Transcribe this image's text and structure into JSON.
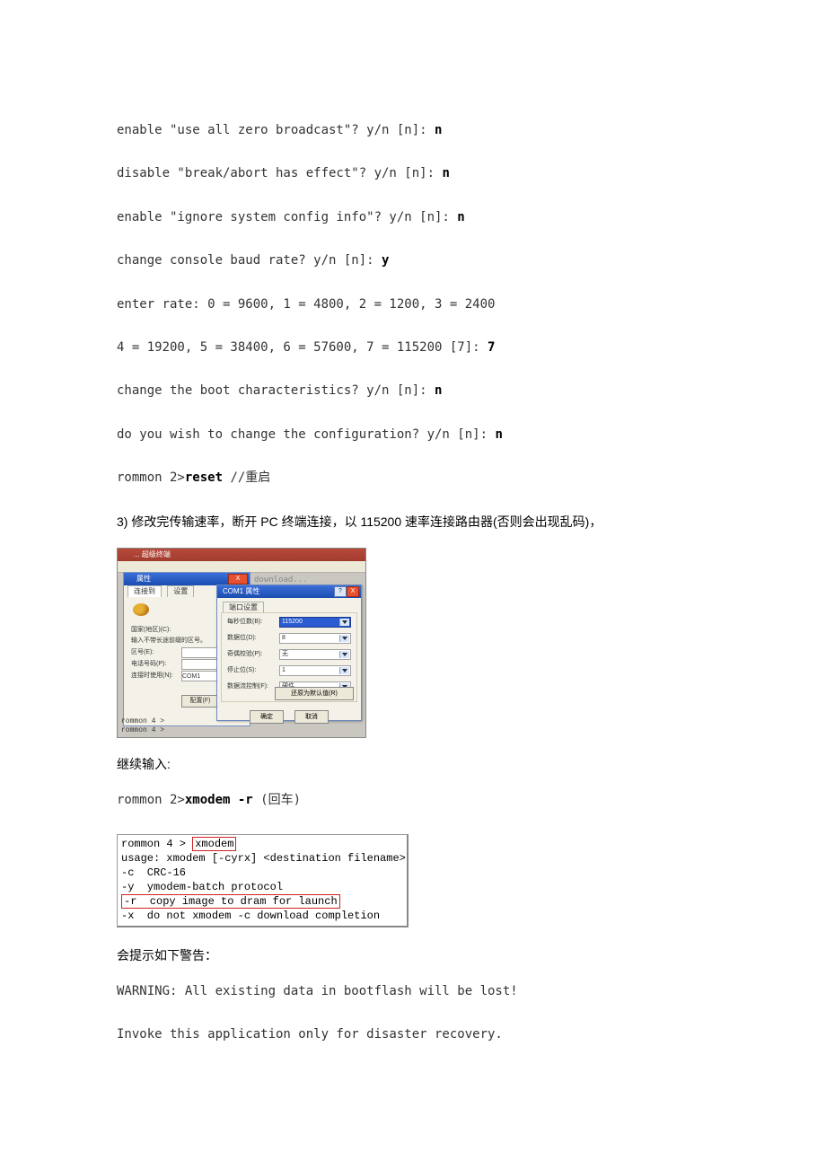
{
  "lines": {
    "l1a": "enable \"use all zero broadcast\"? y/n [n]: ",
    "l1b": "n",
    "l2a": "disable \"break/abort has effect\"? y/n [n]: ",
    "l2b": "n",
    "l3a": "enable \"ignore system config info\"? y/n [n]: ",
    "l3b": "n",
    "l4a": "change console baud rate? y/n [n]: ",
    "l4b": "y",
    "l5": "enter rate: 0 = 9600, 1 = 4800, 2 = 1200, 3 = 2400",
    "l6a": "4 = 19200, 5 = 38400, 6 = 57600, 7 = 115200 [7]: ",
    "l6b": "7",
    "l7a": "change the boot characteristics? y/n [n]: ",
    "l7b": "n",
    "l8a": "do you wish to change the configuration? y/n [n]: ",
    "l8b": "n",
    "l9a": "rommon 2>",
    "l9b": "reset ",
    "l9c": "//重启"
  },
  "step3": "3) 修改完传输速率，断开 PC 终端连接，以 115200 速率连接路由器(否则会出现乱码)，",
  "shot1": {
    "title1": "... 超级终端",
    "bgtext": "download...",
    "prop_title": "属性",
    "prop_tab1": "连接到",
    "prop_tab2": "设置",
    "prop_l1": "国家(地区)(C):",
    "prop_l2": "输入不带长途前缀的区号。",
    "prop_l3": "区号(E):",
    "prop_l4": "电话号码(P):",
    "prop_l5": "连接时使用(N):",
    "prop_l5v": "COM1",
    "prop_btn": "配置(F)",
    "com_title": "COM1 属性",
    "com_tab": "端口设置",
    "com_r1": "每秒位数(B):",
    "com_r1v": "115200",
    "com_r2": "数据位(D):",
    "com_r2v": "8",
    "com_r3": "奇偶校验(P):",
    "com_r3v": "无",
    "com_r4": "停止位(S):",
    "com_r4v": "1",
    "com_r5": "数据流控制(F):",
    "com_r5v": "硬件",
    "com_restore": "还原为默认值(R)",
    "com_ok": "确定",
    "com_cancel": "取消",
    "term": "rommon 4 >\nrommon 4 >"
  },
  "cont": "继续输入:",
  "xline_a": "rommon 2>",
  "xline_b": "xmodem -r ",
  "xline_c": "(回车)",
  "shot2": {
    "l1a": "rommon 4 > ",
    "l1b": "xmodem",
    "l2": "usage: xmodem [-cyrx] <destination filename>",
    "l3": "-c  CRC-16",
    "l4": "-y  ymodem-batch protocol",
    "l5": "-r  copy image to dram for launch",
    "l6": "-x  do not xmodem -c download completion"
  },
  "warnhead": "会提示如下警告：",
  "warn1": "WARNING: All existing data in bootflash will be lost!",
  "warn2": "Invoke this application only for disaster recovery."
}
